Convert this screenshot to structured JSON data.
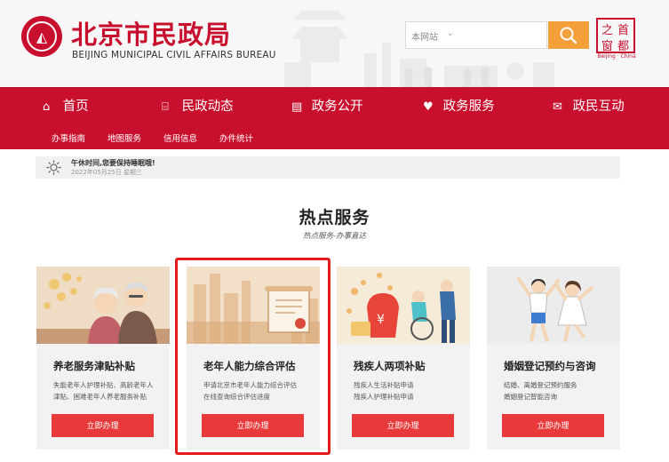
{
  "header": {
    "title": "北京市民政局",
    "subtitle": "BEIJING MUNICIPAL CIVIL AFFAIRS BUREAU",
    "search": {
      "scope": "本网站",
      "placeholder": ""
    },
    "capital_logo": {
      "chars": [
        "首",
        "都",
        "之",
        "窗"
      ],
      "caption": "Beijing · China"
    }
  },
  "nav": {
    "items": [
      {
        "label": "首页",
        "icon": "home-icon"
      },
      {
        "label": "民政动态",
        "icon": "building-icon"
      },
      {
        "label": "政务公开",
        "icon": "document-icon"
      },
      {
        "label": "政务服务",
        "icon": "heart-icon"
      },
      {
        "label": "政民互动",
        "icon": "chat-icon"
      }
    ],
    "subitems": [
      {
        "label": "办事指南"
      },
      {
        "label": "地图服务"
      },
      {
        "label": "信用信息"
      },
      {
        "label": "办件统计"
      }
    ]
  },
  "notice": {
    "icon": "sun-icon",
    "title": "午休时间,您要保持睡眠哦!",
    "date": "2022年05月25日 星期三"
  },
  "hot": {
    "title": "热点服务",
    "subtitle": "热点服务-办事直达"
  },
  "cards": [
    {
      "title": "养老服务津贴补贴",
      "desc1": "失能老年人护理补贴、高龄老年人",
      "desc2": "津贴、困难老年人养老服务补贴",
      "button": "立即办理",
      "image": "elderly-couple-illustration"
    },
    {
      "title": "老年人能力综合评估",
      "desc1": "申请北京市老年人能力综合评估",
      "desc2": "在线查询综合评估进度",
      "button": "立即办理",
      "image": "certificate-city-illustration"
    },
    {
      "title": "残疾人两项补贴",
      "desc1": "残疾人生活补贴申请",
      "desc2": "残疾人护理补贴申请",
      "button": "立即办理",
      "image": "wheelchair-subsidy-illustration"
    },
    {
      "title": "婚姻登记预约与咨询",
      "desc1": "结婚、离婚登记预约服务",
      "desc2": "婚姻登记智能咨询",
      "button": "立即办理",
      "image": "couple-jumping-illustration"
    }
  ],
  "colors": {
    "brand_red": "#c8102e",
    "button_red": "#e8393b",
    "search_orange": "#f4a03a",
    "highlight_red": "#e31a1a"
  }
}
